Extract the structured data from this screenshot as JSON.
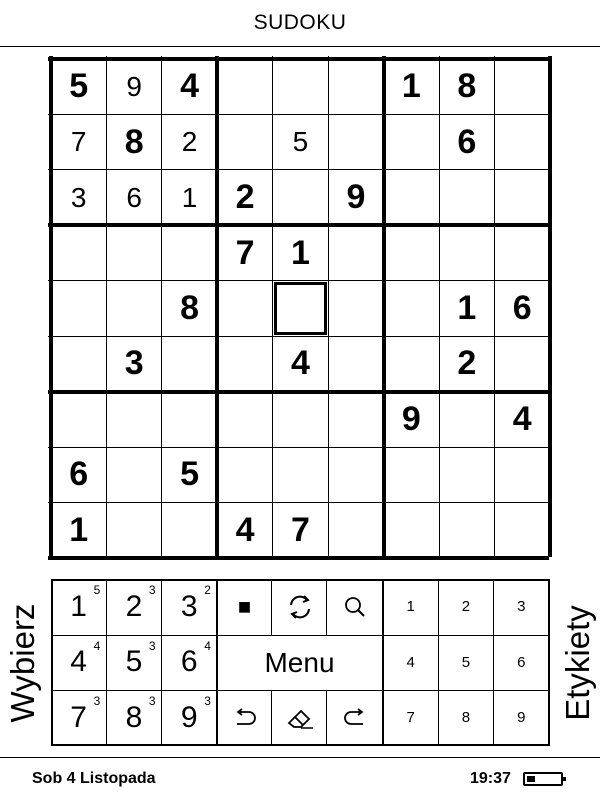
{
  "header": {
    "title": "SUDOKU"
  },
  "board": [
    [
      {
        "v": "5",
        "given": true
      },
      {
        "v": "9",
        "given": false
      },
      {
        "v": "4",
        "given": true
      },
      {
        "v": "",
        "given": false
      },
      {
        "v": "",
        "given": false
      },
      {
        "v": "",
        "given": false
      },
      {
        "v": "1",
        "given": true
      },
      {
        "v": "8",
        "given": true
      },
      {
        "v": "",
        "given": false
      }
    ],
    [
      {
        "v": "7",
        "given": false
      },
      {
        "v": "8",
        "given": true
      },
      {
        "v": "2",
        "given": false
      },
      {
        "v": "",
        "given": false
      },
      {
        "v": "5",
        "given": false
      },
      {
        "v": "",
        "given": false
      },
      {
        "v": "",
        "given": false
      },
      {
        "v": "6",
        "given": true
      },
      {
        "v": "",
        "given": false
      }
    ],
    [
      {
        "v": "3",
        "given": false
      },
      {
        "v": "6",
        "given": false
      },
      {
        "v": "1",
        "given": false
      },
      {
        "v": "2",
        "given": true
      },
      {
        "v": "",
        "given": false
      },
      {
        "v": "9",
        "given": true
      },
      {
        "v": "",
        "given": false
      },
      {
        "v": "",
        "given": false
      },
      {
        "v": "",
        "given": false
      }
    ],
    [
      {
        "v": "",
        "given": false
      },
      {
        "v": "",
        "given": false
      },
      {
        "v": "",
        "given": false
      },
      {
        "v": "7",
        "given": true
      },
      {
        "v": "1",
        "given": true
      },
      {
        "v": "",
        "given": false
      },
      {
        "v": "",
        "given": false
      },
      {
        "v": "",
        "given": false
      },
      {
        "v": "",
        "given": false
      }
    ],
    [
      {
        "v": "",
        "given": false
      },
      {
        "v": "",
        "given": false
      },
      {
        "v": "8",
        "given": true
      },
      {
        "v": "",
        "given": false
      },
      {
        "v": "",
        "given": false
      },
      {
        "v": "",
        "given": false
      },
      {
        "v": "",
        "given": false
      },
      {
        "v": "1",
        "given": true
      },
      {
        "v": "6",
        "given": true
      }
    ],
    [
      {
        "v": "",
        "given": false
      },
      {
        "v": "3",
        "given": true
      },
      {
        "v": "",
        "given": false
      },
      {
        "v": "",
        "given": false
      },
      {
        "v": "4",
        "given": true
      },
      {
        "v": "",
        "given": false
      },
      {
        "v": "",
        "given": false
      },
      {
        "v": "2",
        "given": true
      },
      {
        "v": "",
        "given": false
      }
    ],
    [
      {
        "v": "",
        "given": false
      },
      {
        "v": "",
        "given": false
      },
      {
        "v": "",
        "given": false
      },
      {
        "v": "",
        "given": false
      },
      {
        "v": "",
        "given": false
      },
      {
        "v": "",
        "given": false
      },
      {
        "v": "9",
        "given": true
      },
      {
        "v": "",
        "given": false
      },
      {
        "v": "4",
        "given": true
      }
    ],
    [
      {
        "v": "6",
        "given": true
      },
      {
        "v": "",
        "given": false
      },
      {
        "v": "5",
        "given": true
      },
      {
        "v": "",
        "given": false
      },
      {
        "v": "",
        "given": false
      },
      {
        "v": "",
        "given": false
      },
      {
        "v": "",
        "given": false
      },
      {
        "v": "",
        "given": false
      },
      {
        "v": "",
        "given": false
      }
    ],
    [
      {
        "v": "1",
        "given": true
      },
      {
        "v": "",
        "given": false
      },
      {
        "v": "",
        "given": false
      },
      {
        "v": "4",
        "given": true
      },
      {
        "v": "7",
        "given": true
      },
      {
        "v": "",
        "given": false
      },
      {
        "v": "",
        "given": false
      },
      {
        "v": "",
        "given": false
      },
      {
        "v": "",
        "given": false
      }
    ]
  ],
  "selected_cell": {
    "row": 4,
    "col": 4
  },
  "keypad": {
    "pencil_keys": [
      {
        "digit": "1",
        "count": "5"
      },
      {
        "digit": "2",
        "count": "3"
      },
      {
        "digit": "3",
        "count": "2"
      },
      {
        "digit": "4",
        "count": "4"
      },
      {
        "digit": "5",
        "count": "3"
      },
      {
        "digit": "6",
        "count": "4"
      },
      {
        "digit": "7",
        "count": "3"
      },
      {
        "digit": "8",
        "count": "3"
      },
      {
        "digit": "9",
        "count": "3"
      }
    ],
    "number_keys": [
      "1",
      "2",
      "3",
      "4",
      "5",
      "6",
      "7",
      "8",
      "9"
    ],
    "tools": {
      "stop_icon": "■",
      "refresh_icon": "refresh-icon",
      "search_icon": "search-icon",
      "undo_icon": "undo-icon",
      "eraser_icon": "eraser-icon",
      "redo_icon": "redo-icon",
      "menu_label": "Menu"
    }
  },
  "side_labels": {
    "left": "Wybierz",
    "right": "Etykiety"
  },
  "status_bar": {
    "date": "Sob 4 Listopada",
    "time": "19:37",
    "battery_level": 0.25
  }
}
